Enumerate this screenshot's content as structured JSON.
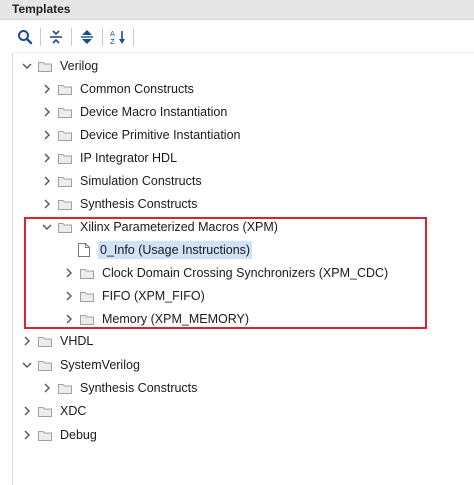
{
  "panel": {
    "title": "Templates"
  },
  "toolbar": {
    "buttons": [
      {
        "name": "search",
        "icon": "search-icon"
      },
      {
        "name": "collapse-all",
        "icon": "collapse-all-icon"
      },
      {
        "name": "expand-all",
        "icon": "expand-all-icon"
      },
      {
        "name": "sort",
        "icon": "sort-az-icon"
      }
    ]
  },
  "tree": {
    "verilog": {
      "label": "Verilog",
      "children": {
        "common": "Common Constructs",
        "device_macro": "Device Macro Instantiation",
        "device_primitive": "Device Primitive Instantiation",
        "ip_integrator": "IP Integrator HDL",
        "simulation": "Simulation Constructs",
        "synthesis": "Synthesis Constructs",
        "xpm": {
          "label": "Xilinx Parameterized Macros (XPM)",
          "children": {
            "info": "0_Info (Usage Instructions)",
            "cdc": "Clock Domain Crossing Synchronizers (XPM_CDC)",
            "fifo": "FIFO (XPM_FIFO)",
            "memory": "Memory (XPM_MEMORY)"
          }
        }
      }
    },
    "vhdl": {
      "label": "VHDL"
    },
    "systemverilog": {
      "label": "SystemVerilog",
      "children": {
        "synthesis": "Synthesis Constructs"
      }
    },
    "xdc": {
      "label": "XDC"
    },
    "debug": {
      "label": "Debug"
    }
  },
  "colors": {
    "highlight_border": "#d9232e",
    "selection": "#cfe2f7",
    "toolbar_icon": "#1e4c8a"
  }
}
